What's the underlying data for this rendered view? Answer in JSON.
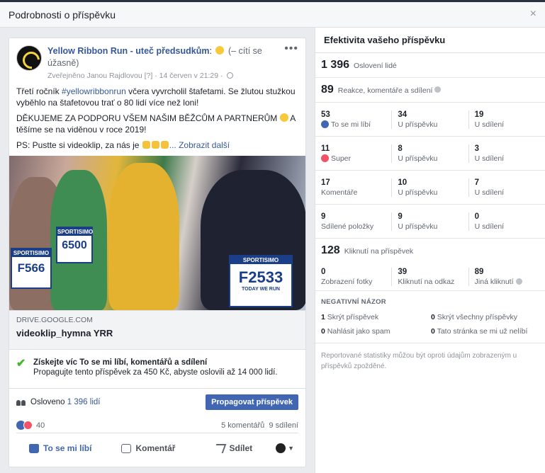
{
  "dialog": {
    "title": "Podrobnosti o příspěvku",
    "close": "×"
  },
  "post": {
    "page_name": "Yellow Ribbon Run - uteč předsudkům",
    "feeling": "(– cítí se úžasně)",
    "meta": "Zveřejněno Janou Rajdlovou",
    "meta_help": "[?]",
    "date": "· 14 červen v 21:29 ·",
    "more": "•••",
    "text1_a": "Třetí ročník ",
    "hashtag": "#yellowribbonrun",
    "text1_b": " včera vyvrcholil štafetami. Se žlutou stužkou vyběhlo na štafetovou trať o 80 lidí více než loni!",
    "text2_a": "DĚKUJEME ZA PODPORU VŠEM NAŠIM BĚŽCŮM A PARTNERŮM ",
    "text2_b": " A těšíme se na viděnou v roce 2019!",
    "text3": "PS: Pustte si videoklip, za nás je ",
    "see_more": "... Zobrazit další",
    "photo": {
      "bib1": "F566",
      "bib2": "6500",
      "bib3": "F2533",
      "sponsor": "SPORTISIMO",
      "bib_sub": "TODAY WE RUN"
    },
    "link_domain": "DRIVE.GOOGLE.COM",
    "link_title": "videoklip_hymna YRR"
  },
  "boost": {
    "title": "Získejte víc To se mi líbí, komentářů a sdílení",
    "subtitle": "Propagujte tento příspěvek za 450 Kč, abyste oslovili až 14 000 lidí."
  },
  "reach": {
    "label": "Osloveno",
    "value": "1 396 lidí",
    "button": "Propagovat příspěvek"
  },
  "engagement": {
    "reactions": "40",
    "comments": "5 komentářů",
    "shares": "9 sdílení"
  },
  "actions": {
    "like": "To se mi líbí",
    "comment": "Komentář",
    "share": "Sdílet"
  },
  "stats": {
    "title": "Efektivita vašeho příspěvku",
    "reach_num": "1 396",
    "reach_label": "Oslovení lidé",
    "react_num": "89",
    "react_label": "Reakce, komentáře a sdílení",
    "rows": [
      {
        "c1n": "53",
        "c1l": "To se mi líbí",
        "c2n": "34",
        "c2l": "U příspěvku",
        "c3n": "19",
        "c3l": "U sdílení"
      },
      {
        "c1n": "11",
        "c1l": "Super",
        "c2n": "8",
        "c2l": "U příspěvku",
        "c3n": "3",
        "c3l": "U sdílení"
      },
      {
        "c1n": "17",
        "c1l": "Komentáře",
        "c2n": "10",
        "c2l": "U příspěvku",
        "c3n": "7",
        "c3l": "U sdílení"
      },
      {
        "c1n": "9",
        "c1l": "Sdílené položky",
        "c2n": "9",
        "c2l": "U příspěvku",
        "c3n": "0",
        "c3l": "U sdílení"
      }
    ],
    "clicks_num": "128",
    "clicks_label": "Kliknutí na příspěvek",
    "clicks": {
      "c1n": "0",
      "c1l": "Zobrazení fotky",
      "c2n": "39",
      "c2l": "Kliknutí na odkaz",
      "c3n": "89",
      "c3l": "Jiná kliknutí"
    },
    "negative_title": "NEGATIVNÍ NÁZOR",
    "negative": [
      {
        "n": "1",
        "l": "Skrýt příspěvek"
      },
      {
        "n": "0",
        "l": "Skrýt všechny příspěvky"
      },
      {
        "n": "0",
        "l": "Nahlásit jako spam"
      },
      {
        "n": "0",
        "l": "Tato stránka se mi už nelíbí"
      }
    ],
    "footnote": "Reportované statistiky můžou být oproti údajům zobrazeným u příspěvků zpožděné."
  },
  "colors": {
    "accent": "#4267b2",
    "link": "#365899",
    "love": "#f25268",
    "check": "#42b72a"
  },
  "icons": [
    "close-icon",
    "globe-icon",
    "more-icon",
    "check-icon",
    "people-icon",
    "like-icon",
    "love-icon",
    "comment-icon",
    "share-icon",
    "info-icon"
  ]
}
